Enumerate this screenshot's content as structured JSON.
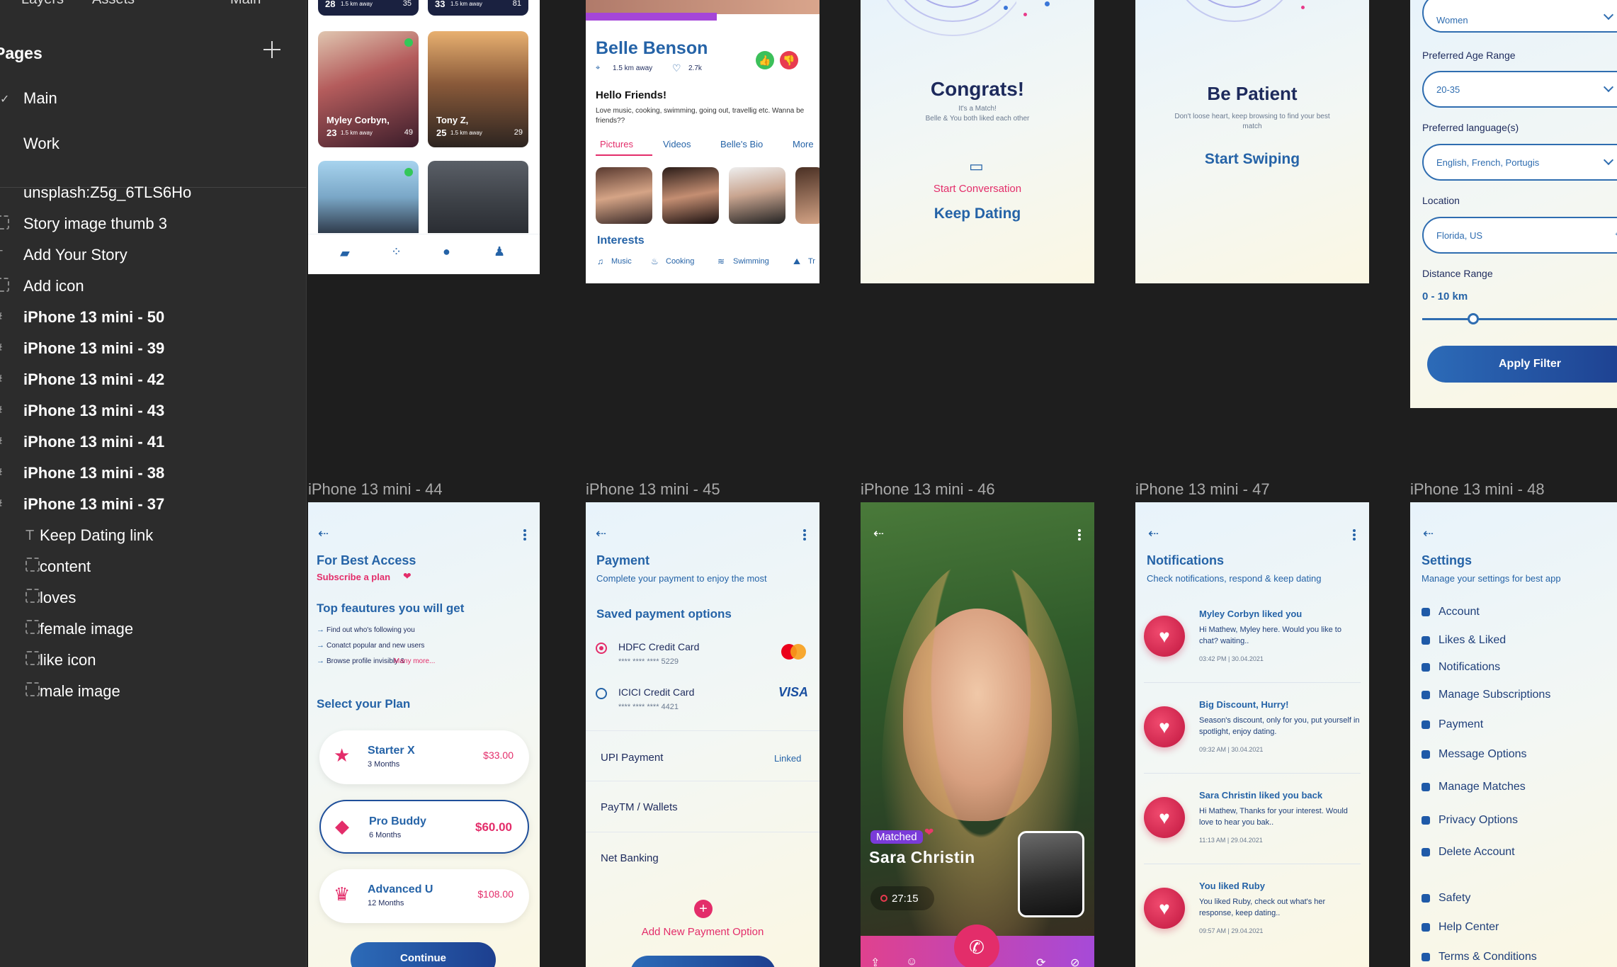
{
  "layers_panel": {
    "tabs": [
      "Layers",
      "Assets",
      "Main"
    ],
    "pages_heading": "Pages",
    "pages": [
      "Main",
      "Work"
    ],
    "layers": [
      {
        "label": "unsplash:Z5g_6TLS6Ho",
        "kind": "image",
        "indent": 0
      },
      {
        "label": "Story image thumb 3",
        "kind": "group",
        "indent": 0
      },
      {
        "label": "Add Your Story",
        "kind": "text",
        "indent": 0
      },
      {
        "label": "Add icon",
        "kind": "group",
        "indent": 0
      },
      {
        "label": "iPhone 13 mini - 50",
        "kind": "frame",
        "indent": 0
      },
      {
        "label": "iPhone 13 mini - 39",
        "kind": "frame",
        "indent": 0
      },
      {
        "label": "iPhone 13 mini - 42",
        "kind": "frame",
        "indent": 0
      },
      {
        "label": "iPhone 13 mini - 43",
        "kind": "frame",
        "indent": 0
      },
      {
        "label": "iPhone 13 mini - 41",
        "kind": "frame",
        "indent": 0
      },
      {
        "label": "iPhone 13 mini - 38",
        "kind": "frame",
        "indent": 0
      },
      {
        "label": "iPhone 13 mini - 37",
        "kind": "frame",
        "indent": 0
      },
      {
        "label": "Keep Dating link",
        "kind": "text",
        "indent": 1
      },
      {
        "label": "content",
        "kind": "group",
        "indent": 1
      },
      {
        "label": "loves",
        "kind": "group",
        "indent": 1
      },
      {
        "label": "female image",
        "kind": "group",
        "indent": 1
      },
      {
        "label": "like icon",
        "kind": "group",
        "indent": 1
      },
      {
        "label": "male image",
        "kind": "group",
        "indent": 1
      }
    ]
  },
  "frame_labels": [
    "iPhone 13 mini - 44",
    "iPhone 13 mini - 45",
    "iPhone 13 mini - 46",
    "iPhone 13 mini - 47",
    "iPhone 13 mini - 48"
  ],
  "discover": {
    "top_cards": [
      {
        "age": "28",
        "dist": "1.5 km away",
        "count": "35"
      },
      {
        "age": "33",
        "dist": "1.5 km away",
        "count": "81"
      }
    ],
    "cards": [
      {
        "name": "Myley Corbyn,",
        "age": "23",
        "dist": "1.5 km away",
        "count": "49"
      },
      {
        "name": "Tony Z,",
        "age": "25",
        "dist": "1.5 km away",
        "count": "29"
      }
    ]
  },
  "profile": {
    "name": "Belle Benson",
    "distance": "1.5 km away",
    "likes": "2.7k",
    "greeting": "Hello Friends!",
    "bio": "Love music, cooking, swimming, going out, travellig etc. Wanna be friends??",
    "tabs": [
      "Pictures",
      "Videos",
      "Belle's Bio",
      "More"
    ],
    "interests_title": "Interests",
    "interests": [
      "Music",
      "Cooking",
      "Swimming",
      "Tr"
    ]
  },
  "congrats": {
    "title": "Congrats!",
    "sub1": "It's a Match!",
    "sub2": "Belle & You both liked each other",
    "start_conversation": "Start Conversation",
    "keep_dating": "Keep Dating"
  },
  "patient": {
    "title": "Be Patient",
    "sub": "Don't loose heart, keep browsing to find your best match",
    "cta": "Start Swiping"
  },
  "filter": {
    "gender": "Women",
    "age_label": "Preferred Age Range",
    "age": "20-35",
    "lang_label": "Preferred language(s)",
    "lang": "English, French, Portugis",
    "loc_label": "Location",
    "loc": "Florida, US",
    "dist_label": "Distance Range",
    "dist": "0 - 10 km",
    "slider_fraction": 0.24,
    "apply": "Apply Filter"
  },
  "plans": {
    "title": "For Best Access",
    "subtitle": "Subscribe a plan",
    "features_title": "Top feautures you will get",
    "features": [
      "Find out who's following you",
      "Conatct popular and new users",
      "Browse profile invisibly &"
    ],
    "many_more": "Many more...",
    "select_title": "Select your Plan",
    "options": [
      {
        "name": "Starter X",
        "duration": "3 Months",
        "price": "$33.00"
      },
      {
        "name": "Pro Buddy",
        "duration": "6 Months",
        "price": "$60.00"
      },
      {
        "name": "Advanced U",
        "duration": "12 Months",
        "price": "$108.00"
      }
    ],
    "continue": "Continue"
  },
  "payment": {
    "title": "Payment",
    "subtitle": "Complete your payment to enjoy the most",
    "saved_title": "Saved payment options",
    "cards": [
      {
        "name": "HDFC Credit Card",
        "number": "**** **** **** 5229",
        "brand": "mastercard"
      },
      {
        "name": "ICICI Credit Card",
        "number": "**** **** **** 4421",
        "brand": "VISA"
      }
    ],
    "upi": "UPI Payment",
    "upi_status": "Linked",
    "paytm": "PayTM / Wallets",
    "netbanking": "Net Banking",
    "add": "Add New Payment Option"
  },
  "call": {
    "badge": "Matched",
    "name": "Sara Christin",
    "timer": "27:15"
  },
  "notifications": {
    "title": "Notifications",
    "subtitle": "Check notifications, respond & keep dating",
    "items": [
      {
        "title": "Myley Corbyn liked you",
        "body": "Hi Mathew, Myley here. Would you like to chat? waiting..",
        "time": "03:42 PM  |  30.04.2021"
      },
      {
        "title": "Big Discount, Hurry!",
        "body": "Season's discount, only for you, put yourself in spotlight, enjoy dating.",
        "time": "09:32 AM  |  30.04.2021"
      },
      {
        "title": "Sara Christin liked you back",
        "body": "Hi Mathew, Thanks for your interest. Would love to hear you bak..",
        "time": "11:13 AM  |  29.04.2021"
      },
      {
        "title": "You liked Ruby",
        "body": "You liked Ruby, check out what's her response, keep dating..",
        "time": "09:57 AM  |  29.04.2021"
      }
    ]
  },
  "settings": {
    "title": "Settings",
    "subtitle": "Manage your settings for best app",
    "items": [
      "Account",
      "Likes & Liked",
      "Notifications",
      "Manage Subscriptions",
      "Payment",
      "Message Options",
      "Manage Matches",
      "Privacy Options",
      "Delete Account",
      "Safety",
      "Help Center",
      "Terms & Conditions"
    ]
  },
  "colors": {
    "canvas": "#1e1e1e",
    "panel": "#2c2c2c",
    "brand_blue": "#2563a7",
    "brand_pink": "#e32d6a"
  }
}
